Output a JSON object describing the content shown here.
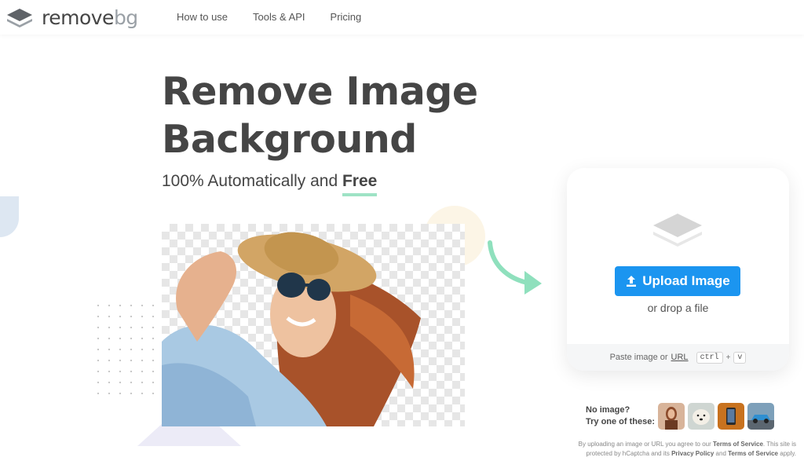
{
  "header": {
    "brand_main": "remove",
    "brand_suffix": "bg",
    "nav": [
      {
        "label": "How to use"
      },
      {
        "label": "Tools & API"
      },
      {
        "label": "Pricing"
      }
    ]
  },
  "hero": {
    "title_line1": "Remove Image",
    "title_line2": "Background",
    "subtitle_prefix": "100% Automatically and ",
    "subtitle_emphasis": "Free"
  },
  "upload": {
    "button_label": "Upload Image",
    "drop_text": "or drop a file",
    "paste_prefix": "Paste image or",
    "paste_link": "URL",
    "key_ctrl": "ctrl",
    "key_plus": "+",
    "key_v": "v"
  },
  "samples": {
    "prompt_line1": "No image?",
    "prompt_line2": "Try one of these:",
    "items": [
      "woman-thumbnail",
      "dog-thumbnail",
      "phone-thumbnail",
      "car-thumbnail"
    ]
  },
  "legal": {
    "text1": "By uploading an image or URL you agree to our ",
    "tos1": "Terms of Service",
    "text2": ". This site is protected by hCaptcha and its ",
    "privacy": "Privacy Policy",
    "text3": " and ",
    "tos2": "Terms of Service",
    "text4": " apply."
  },
  "colors": {
    "accent_blue": "#1b95f0",
    "accent_green": "#9ee3c5",
    "text_dark": "#454545"
  }
}
